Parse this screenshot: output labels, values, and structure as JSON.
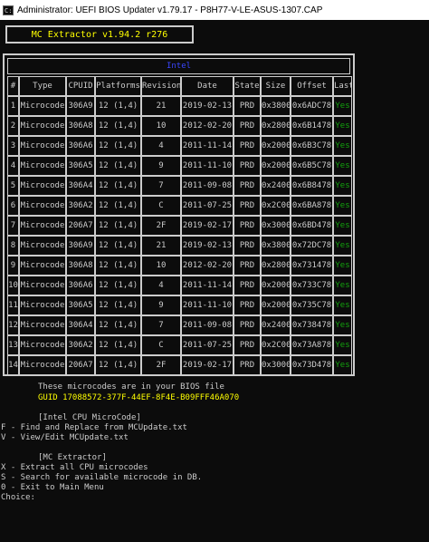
{
  "window": {
    "icon_label": "C:\\",
    "title": "Administrator:  UEFI BIOS Updater v1.79.17 - P8H77-V-LE-ASUS-1307.CAP"
  },
  "app_title": "MC Extractor v1.94.2 r276",
  "vendor": "Intel",
  "table": {
    "headers": [
      "#",
      "Type",
      "CPUID",
      "Platforms",
      "Revision",
      "Date",
      "State",
      "Size",
      "Offset",
      "Last"
    ],
    "rows": [
      [
        "1",
        "Microcode",
        "306A9",
        "12 (1,4)",
        "21",
        "2019-02-13",
        "PRD",
        "0x3800",
        "0x6ADC78",
        "Yes"
      ],
      [
        "2",
        "Microcode",
        "306A8",
        "12 (1,4)",
        "10",
        "2012-02-20",
        "PRD",
        "0x2800",
        "0x6B1478",
        "Yes"
      ],
      [
        "3",
        "Microcode",
        "306A6",
        "12 (1,4)",
        "4",
        "2011-11-14",
        "PRD",
        "0x2000",
        "0x6B3C78",
        "Yes"
      ],
      [
        "4",
        "Microcode",
        "306A5",
        "12 (1,4)",
        "9",
        "2011-11-10",
        "PRD",
        "0x2000",
        "0x6B5C78",
        "Yes"
      ],
      [
        "5",
        "Microcode",
        "306A4",
        "12 (1,4)",
        "7",
        "2011-09-08",
        "PRD",
        "0x2400",
        "0x6B8478",
        "Yes"
      ],
      [
        "6",
        "Microcode",
        "306A2",
        "12 (1,4)",
        "C",
        "2011-07-25",
        "PRD",
        "0x2C00",
        "0x6BA878",
        "Yes"
      ],
      [
        "7",
        "Microcode",
        "206A7",
        "12 (1,4)",
        "2F",
        "2019-02-17",
        "PRD",
        "0x3000",
        "0x6BD478",
        "Yes"
      ],
      [
        "8",
        "Microcode",
        "306A9",
        "12 (1,4)",
        "21",
        "2019-02-13",
        "PRD",
        "0x3800",
        "0x72DC78",
        "Yes"
      ],
      [
        "9",
        "Microcode",
        "306A8",
        "12 (1,4)",
        "10",
        "2012-02-20",
        "PRD",
        "0x2800",
        "0x731478",
        "Yes"
      ],
      [
        "10",
        "Microcode",
        "306A6",
        "12 (1,4)",
        "4",
        "2011-11-14",
        "PRD",
        "0x2000",
        "0x733C78",
        "Yes"
      ],
      [
        "11",
        "Microcode",
        "306A5",
        "12 (1,4)",
        "9",
        "2011-11-10",
        "PRD",
        "0x2000",
        "0x735C78",
        "Yes"
      ],
      [
        "12",
        "Microcode",
        "306A4",
        "12 (1,4)",
        "7",
        "2011-09-08",
        "PRD",
        "0x2400",
        "0x738478",
        "Yes"
      ],
      [
        "13",
        "Microcode",
        "306A2",
        "12 (1,4)",
        "C",
        "2011-07-25",
        "PRD",
        "0x2C00",
        "0x73A878",
        "Yes"
      ],
      [
        "14",
        "Microcode",
        "206A7",
        "12 (1,4)",
        "2F",
        "2019-02-17",
        "PRD",
        "0x3000",
        "0x73D478",
        "Yes"
      ]
    ]
  },
  "footer": {
    "info": "These microcodes are in your BIOS file",
    "guid": "GUID 17088572-377F-44EF-8F4E-B09FFF46A070",
    "section1_title": "[Intel CPU MicroCode]",
    "f_option": "F - Find and Replace from MCUpdate.txt",
    "v_option": "V - View/Edit MCUpdate.txt",
    "section2_title": "[MC Extractor]",
    "x_option": "X - Extract all CPU microcodes",
    "s_option": "S - Search for available microcode in DB.",
    "zero_option": "0 - Exit to Main Menu",
    "prompt": "Choice:"
  },
  "colors": {
    "background": "#0c0c0c",
    "text": "#cccccc",
    "yellow": "#ffff00",
    "green": "#13a10e",
    "blue": "#3a46ff"
  }
}
